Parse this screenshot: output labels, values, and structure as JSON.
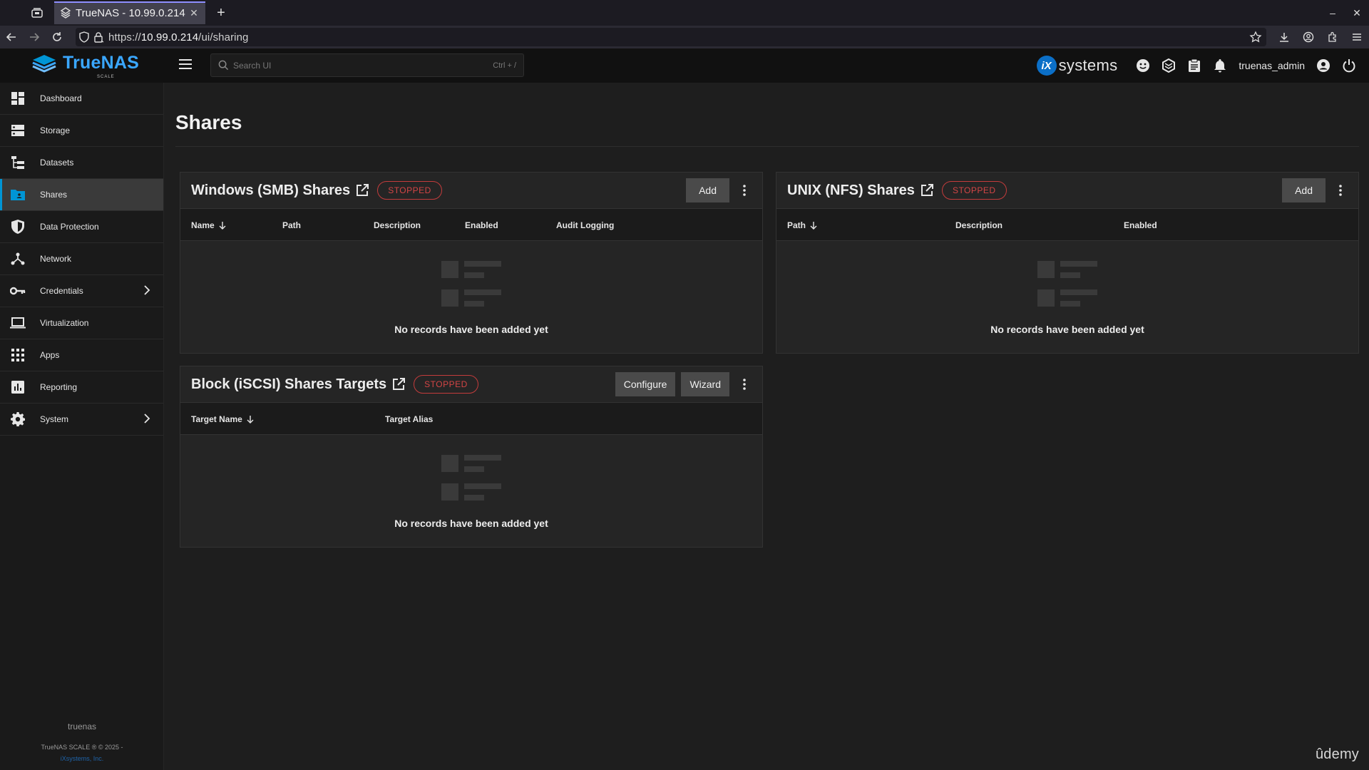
{
  "browser": {
    "tab_title": "TrueNAS - 10.99.0.214",
    "url_prefix": "https://",
    "url_host": "10.99.0.214",
    "url_path": "/ui/sharing"
  },
  "topbar": {
    "brand": "TrueNAS",
    "brand_sub": "SCALE",
    "search_placeholder": "Search UI",
    "search_shortcut": "Ctrl + /",
    "vendor_mark": "iX",
    "vendor_word": "systems",
    "username": "truenas_admin"
  },
  "sidebar": {
    "items": [
      {
        "label": "Dashboard"
      },
      {
        "label": "Storage"
      },
      {
        "label": "Datasets"
      },
      {
        "label": "Shares"
      },
      {
        "label": "Data Protection"
      },
      {
        "label": "Network"
      },
      {
        "label": "Credentials"
      },
      {
        "label": "Virtualization"
      },
      {
        "label": "Apps"
      },
      {
        "label": "Reporting"
      },
      {
        "label": "System"
      }
    ],
    "hostname": "truenas",
    "copyright": "TrueNAS SCALE ® © 2025 -",
    "company": "iXsystems, Inc."
  },
  "page": {
    "title": "Shares"
  },
  "smb": {
    "title": "Windows (SMB) Shares",
    "status": "STOPPED",
    "add_label": "Add",
    "columns": [
      "Name",
      "Path",
      "Description",
      "Enabled",
      "Audit Logging"
    ],
    "empty_text": "No records have been added yet"
  },
  "nfs": {
    "title": "UNIX (NFS) Shares",
    "status": "STOPPED",
    "add_label": "Add",
    "columns": [
      "Path",
      "Description",
      "Enabled"
    ],
    "empty_text": "No records have been added yet"
  },
  "iscsi": {
    "title": "Block (iSCSI) Shares Targets",
    "status": "STOPPED",
    "configure_label": "Configure",
    "wizard_label": "Wizard",
    "columns": [
      "Target Name",
      "Target Alias"
    ],
    "empty_text": "No records have been added yet"
  },
  "watermark": "ûdemy",
  "colors": {
    "accent": "#0095d5",
    "brand": "#3aa7ff",
    "stopped": "#d34545",
    "background": "#1e1e1e",
    "card": "#252525"
  }
}
